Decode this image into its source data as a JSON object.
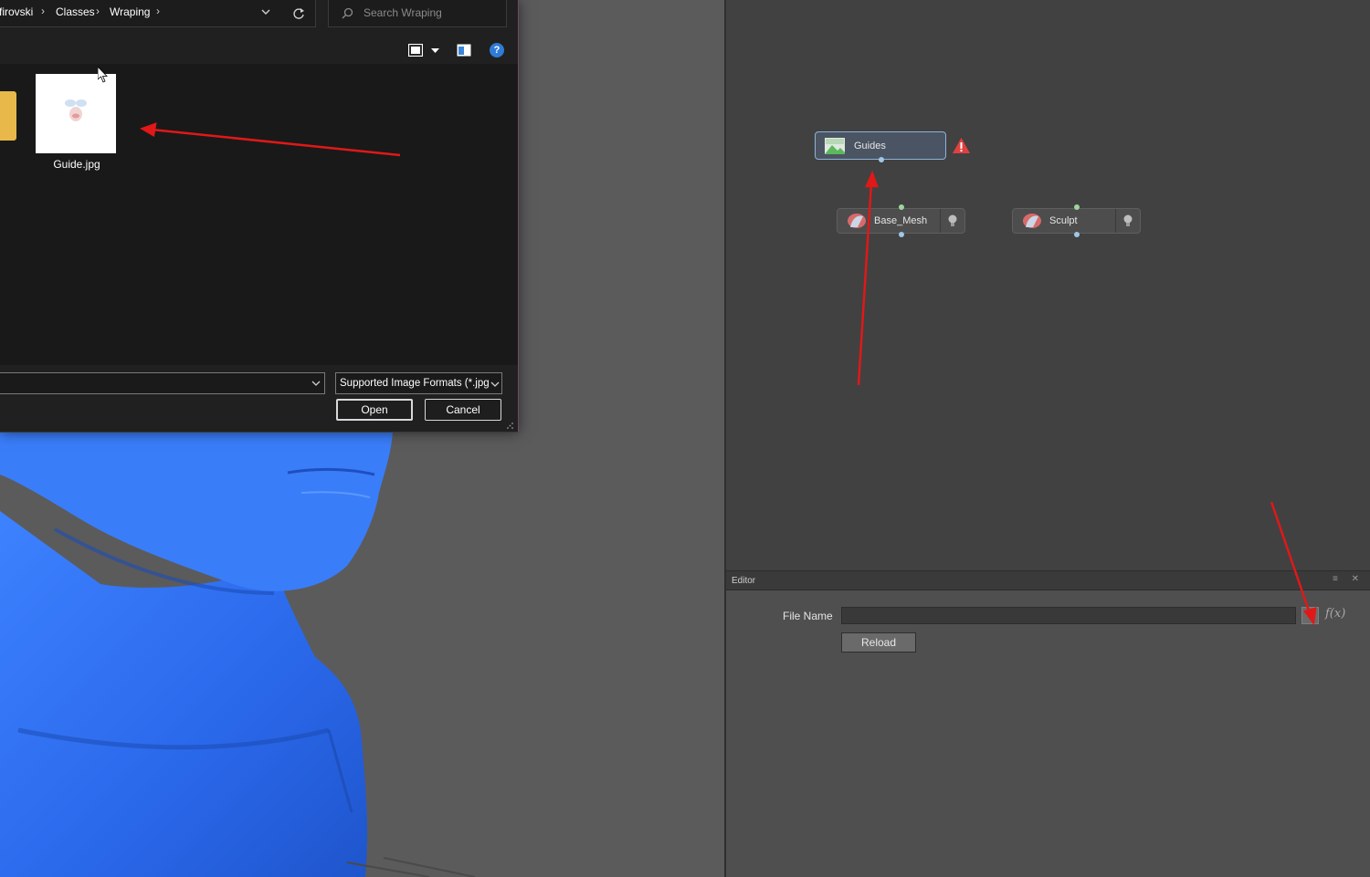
{
  "file_dialog": {
    "breadcrumb": [
      "firovski",
      "Classes",
      "Wraping"
    ],
    "breadcrumb_separator": "›",
    "search_placeholder": "Search Wraping",
    "file": {
      "name": "Guide.jpg"
    },
    "file_type_filter": "Supported Image Formats (*.jpg",
    "open_label": "Open",
    "cancel_label": "Cancel",
    "help_glyph": "?"
  },
  "node_graph": {
    "nodes": [
      {
        "label": "Guides",
        "icon": "image-icon",
        "status": "warning-icon",
        "selected": true
      },
      {
        "label": "Base_Mesh",
        "icon": "mesh-icon",
        "toggle": "bulb-icon"
      },
      {
        "label": "Sculpt",
        "icon": "mesh-icon",
        "toggle": "bulb-icon"
      }
    ]
  },
  "editor": {
    "title": "Editor",
    "header_icons": "≡ ✕",
    "file_name_label": "File Name",
    "file_name_value": "",
    "browse_label": "...",
    "fx_label": "f(x)",
    "reload_label": "Reload"
  },
  "colors": {
    "model_blue": "#2f6ef2",
    "annotation_red": "#e01818",
    "selected_node_border": "#8db3da",
    "warning_red": "#e04040"
  }
}
